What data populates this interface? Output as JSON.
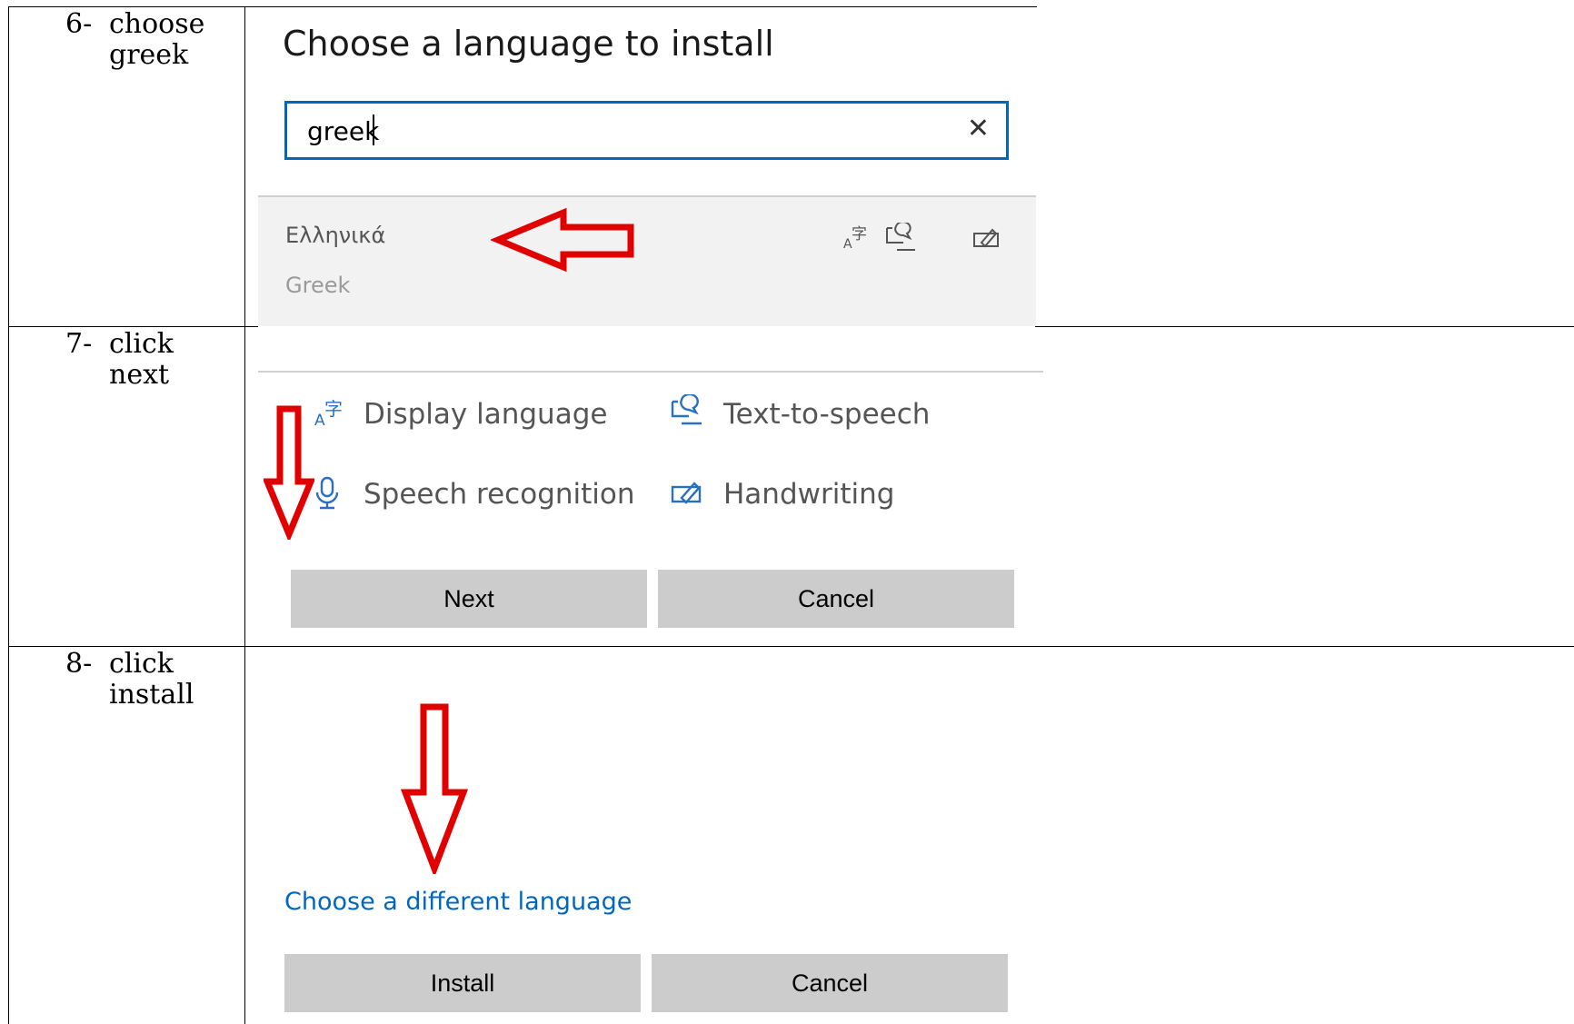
{
  "steps": [
    {
      "num": "6-",
      "line1": "choose",
      "line2": "greek"
    },
    {
      "num": "7-",
      "line1": "click",
      "line2": "next"
    },
    {
      "num": "8-",
      "line1": "click",
      "line2": "install"
    }
  ],
  "dialog1": {
    "title": "Choose a language to install",
    "search_value": "greek",
    "result": {
      "native_name": "Ελληνικά",
      "english_name": "Greek"
    }
  },
  "dialog2": {
    "features": [
      {
        "icon": "display-language-icon",
        "label": "Display language"
      },
      {
        "icon": "text-to-speech-icon",
        "label": "Text-to-speech"
      },
      {
        "icon": "microphone-icon",
        "label": "Speech recognition"
      },
      {
        "icon": "handwriting-icon",
        "label": "Handwriting"
      }
    ],
    "next_label": "Next",
    "cancel_label": "Cancel"
  },
  "dialog3": {
    "link_label": "Choose a different language",
    "install_label": "Install",
    "cancel_label": "Cancel"
  },
  "colors": {
    "accent": "#0067c0",
    "arrow": "#e00000",
    "button": "#cccccc"
  }
}
